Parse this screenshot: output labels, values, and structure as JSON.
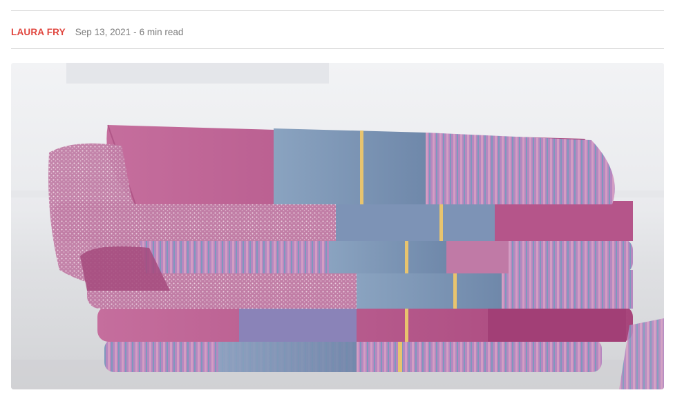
{
  "post": {
    "author": "LAURA FRY",
    "date": "Sep 13, 2021",
    "separator": "-",
    "read_time": "6 min read"
  },
  "hero_image": {
    "subject": "stack of folded handwoven tea towels",
    "palette": {
      "magenta": "#b04a83",
      "pink": "#c783ab",
      "blue": "#7f9bb8",
      "lilac": "#9a86c2",
      "background": "#eceef1",
      "counter": "#d5d6d9"
    }
  }
}
